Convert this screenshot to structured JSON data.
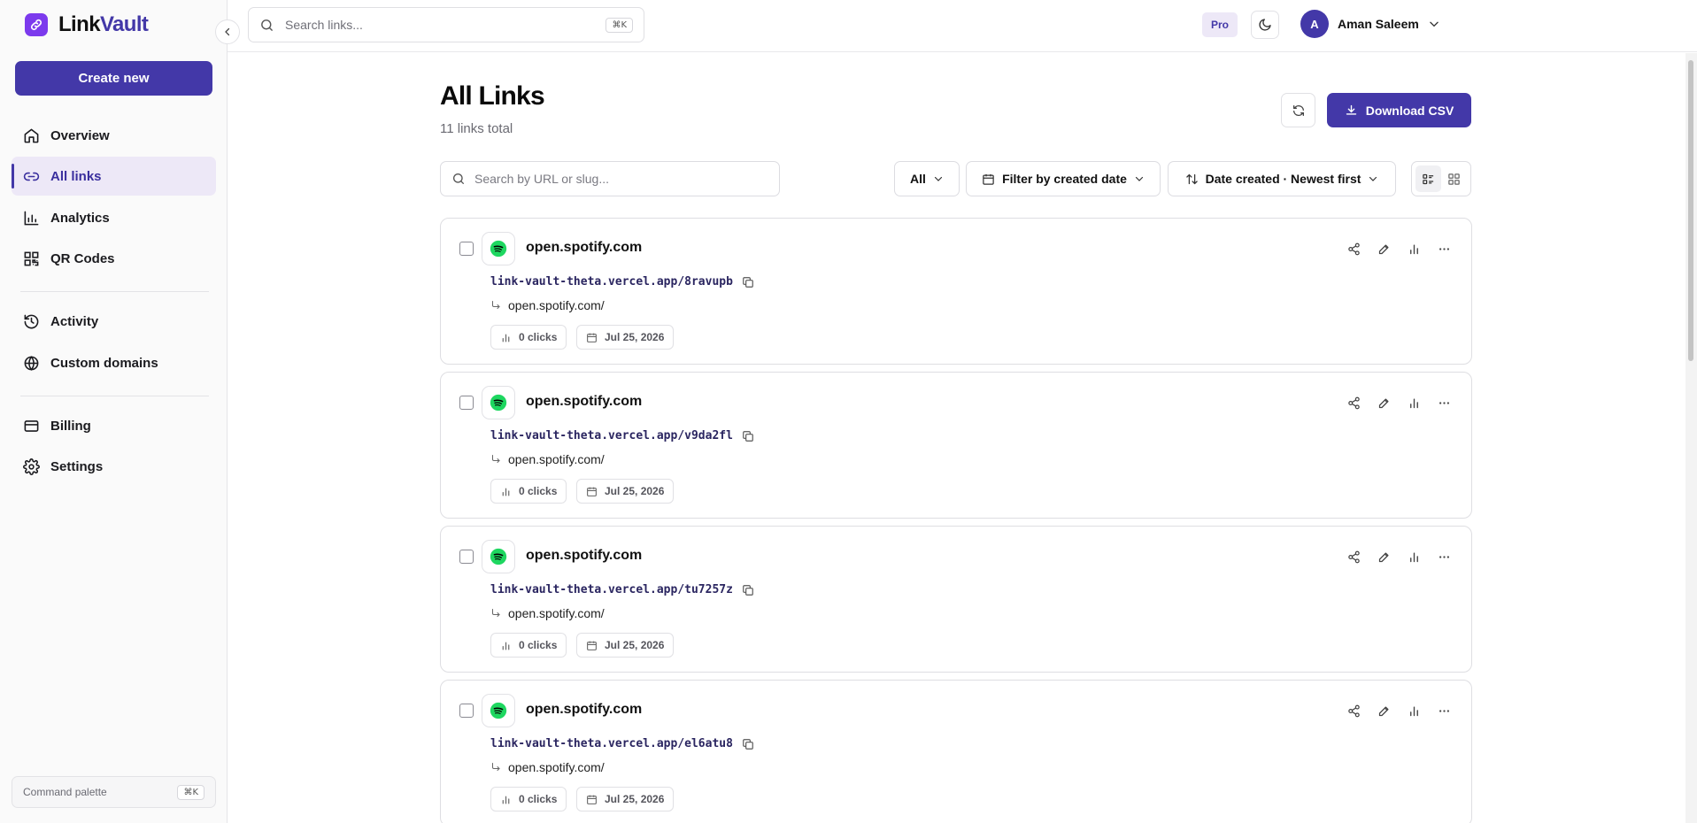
{
  "app": {
    "name_part1": "Link",
    "name_part2": "Vault",
    "accent_color": "#4338a8",
    "logo_color": "#7c3aed"
  },
  "sidebar": {
    "create_label": "Create new",
    "items": [
      {
        "label": "Overview",
        "icon": "home-icon",
        "active": false
      },
      {
        "label": "All links",
        "icon": "link-icon",
        "active": true
      },
      {
        "label": "Analytics",
        "icon": "bar-chart-icon",
        "active": false
      },
      {
        "label": "QR Codes",
        "icon": "qr-code-icon",
        "active": false
      },
      {
        "label": "Activity",
        "icon": "history-icon",
        "active": false
      },
      {
        "label": "Custom domains",
        "icon": "globe-icon",
        "active": false
      },
      {
        "label": "Billing",
        "icon": "credit-card-icon",
        "active": false
      },
      {
        "label": "Settings",
        "icon": "gear-icon",
        "active": false
      }
    ],
    "command_palette": {
      "label": "Command palette",
      "shortcut": "⌘K"
    }
  },
  "topbar": {
    "search_placeholder": "Search links...",
    "search_shortcut": "⌘K",
    "plan_badge": "Pro",
    "user_initial": "A",
    "user_name": "Aman Saleem"
  },
  "main": {
    "title": "All Links",
    "subtitle": "11 links total",
    "download_label": "Download CSV",
    "filter_search_placeholder": "Search by URL or slug...",
    "filter_status": "All",
    "filter_date": "Filter by created date",
    "sort_label": "Date created · Newest first"
  },
  "links": [
    {
      "domain": "open.spotify.com",
      "short_url": "link-vault-theta.vercel.app/8ravupb",
      "destination": "open.spotify.com/",
      "clicks": "0 clicks",
      "date": "Jul 25, 2026"
    },
    {
      "domain": "open.spotify.com",
      "short_url": "link-vault-theta.vercel.app/v9da2fl",
      "destination": "open.spotify.com/",
      "clicks": "0 clicks",
      "date": "Jul 25, 2026"
    },
    {
      "domain": "open.spotify.com",
      "short_url": "link-vault-theta.vercel.app/tu7257z",
      "destination": "open.spotify.com/",
      "clicks": "0 clicks",
      "date": "Jul 25, 2026"
    },
    {
      "domain": "open.spotify.com",
      "short_url": "link-vault-theta.vercel.app/el6atu8",
      "destination": "open.spotify.com/",
      "clicks": "0 clicks",
      "date": "Jul 25, 2026"
    }
  ],
  "favicon_color": "#1ed760"
}
